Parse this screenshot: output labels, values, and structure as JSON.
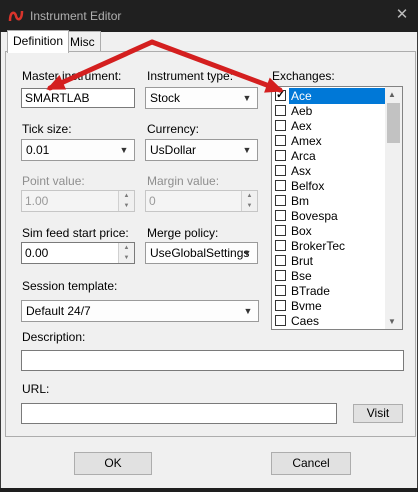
{
  "window": {
    "title": "Instrument Editor",
    "close_glyph": "✕",
    "accent": "#c42b1c"
  },
  "tabs": [
    {
      "label": "Definition",
      "active": true
    },
    {
      "label": "Misc",
      "active": false
    }
  ],
  "fields": {
    "master_instrument": {
      "label": "Master instrument:",
      "value": "SMARTLAB"
    },
    "instrument_type": {
      "label": "Instrument type:",
      "value": "Stock"
    },
    "tick_size": {
      "label": "Tick size:",
      "value": "0.01"
    },
    "currency": {
      "label": "Currency:",
      "value": "UsDollar"
    },
    "point_value": {
      "label": "Point value:",
      "value": "1.00"
    },
    "margin_value": {
      "label": "Margin value:",
      "value": "0"
    },
    "sim_feed_start_price": {
      "label": "Sim feed start price:",
      "value": "0.00"
    },
    "merge_policy": {
      "label": "Merge policy:",
      "value": "UseGlobalSettings"
    },
    "session_template": {
      "label": "Session template:",
      "value": "Default 24/7"
    },
    "description": {
      "label": "Description:",
      "value": ""
    },
    "url": {
      "label": "URL:",
      "value": ""
    }
  },
  "exchanges": {
    "label": "Exchanges:",
    "items": [
      {
        "name": "Ace",
        "checked": true,
        "selected": true
      },
      {
        "name": "Aeb",
        "checked": false
      },
      {
        "name": "Aex",
        "checked": false
      },
      {
        "name": "Amex",
        "checked": false
      },
      {
        "name": "Arca",
        "checked": false
      },
      {
        "name": "Asx",
        "checked": false
      },
      {
        "name": "Belfox",
        "checked": false
      },
      {
        "name": "Bm",
        "checked": false
      },
      {
        "name": "Bovespa",
        "checked": false
      },
      {
        "name": "Box",
        "checked": false
      },
      {
        "name": "BrokerTec",
        "checked": false
      },
      {
        "name": "Brut",
        "checked": false
      },
      {
        "name": "Bse",
        "checked": false
      },
      {
        "name": "BTrade",
        "checked": false
      },
      {
        "name": "Bvme",
        "checked": false
      },
      {
        "name": "Caes",
        "checked": false
      }
    ]
  },
  "buttons": {
    "visit": "Visit",
    "ok": "OK",
    "cancel": "Cancel"
  },
  "icons": {
    "arrow_down": "▼",
    "spin_up": "▲",
    "spin_down": "▼",
    "check": "✓"
  },
  "annotation_color": "#d41f1f"
}
